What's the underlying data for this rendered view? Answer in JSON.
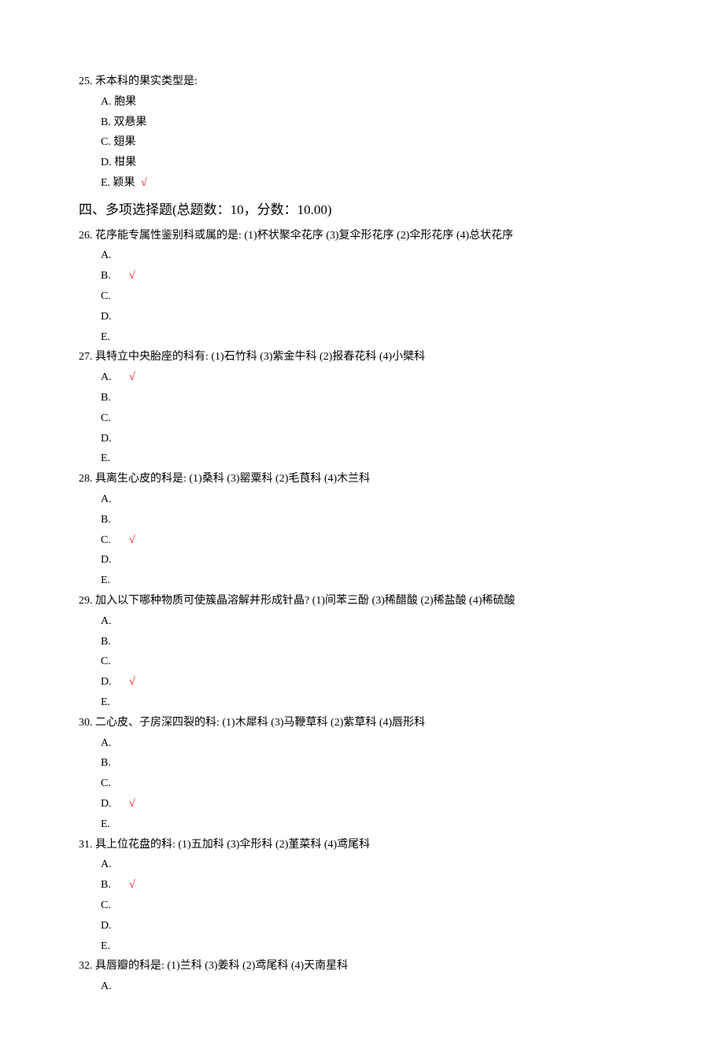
{
  "q25": {
    "stem": "25. 禾本科的果实类型是:",
    "choices": [
      {
        "label": "A. 胞果",
        "check": ""
      },
      {
        "label": "B. 双悬果",
        "check": ""
      },
      {
        "label": "C. 翅果",
        "check": ""
      },
      {
        "label": "D. 柑果",
        "check": ""
      },
      {
        "label": "E. 颖果",
        "check": "√"
      }
    ]
  },
  "section4_title": "四、多项选择题(总题数：10，分数：10.00)",
  "q26": {
    "stem": "26. 花序能专属性鉴别科或属的是:   (1)杯状聚伞花序 (3)复伞形花序 (2)伞形花序 (4)总状花序",
    "letters": [
      "A.",
      "B.",
      "C.",
      "D.",
      "E."
    ],
    "correct_idx": 1
  },
  "q27": {
    "stem": "27. 具特立中央胎座的科有:   (1)石竹科 (3)紫金牛科 (2)报春花科 (4)小檗科",
    "letters": [
      "A.",
      "B.",
      "C.",
      "D.",
      "E."
    ],
    "correct_idx": 0
  },
  "q28": {
    "stem": "28. 具离生心皮的科是:   (1)桑科 (3)罂粟科 (2)毛茛科 (4)木兰科",
    "letters": [
      "A.",
      "B.",
      "C.",
      "D.",
      "E."
    ],
    "correct_idx": 2
  },
  "q29": {
    "stem": "29. 加入以下哪种物质可使簇晶溶解并形成针晶? (1)间苯三酚 (3)稀醋酸 (2)稀盐酸 (4)稀硫酸",
    "letters": [
      "A.",
      "B.",
      "C.",
      "D.",
      "E."
    ],
    "correct_idx": 3
  },
  "q30": {
    "stem": "30. 二心皮、子房深四裂的科:   (1)木犀科 (3)马鞭草科 (2)紫草科 (4)唇形科",
    "letters": [
      "A.",
      "B.",
      "C.",
      "D.",
      "E."
    ],
    "correct_idx": 3
  },
  "q31": {
    "stem": "31. 具上位花盘的科:   (1)五加科 (3)伞形科 (2)堇菜科 (4)鸢尾科",
    "letters": [
      "A.",
      "B.",
      "C.",
      "D.",
      "E."
    ],
    "correct_idx": 1
  },
  "q32": {
    "stem": "32. 具唇瓣的科是:   (1)兰科 (3)姜科 (2)鸢尾科 (4)天南星科",
    "letters": [
      "A."
    ],
    "correct_idx": -1
  },
  "check_mark": "√"
}
